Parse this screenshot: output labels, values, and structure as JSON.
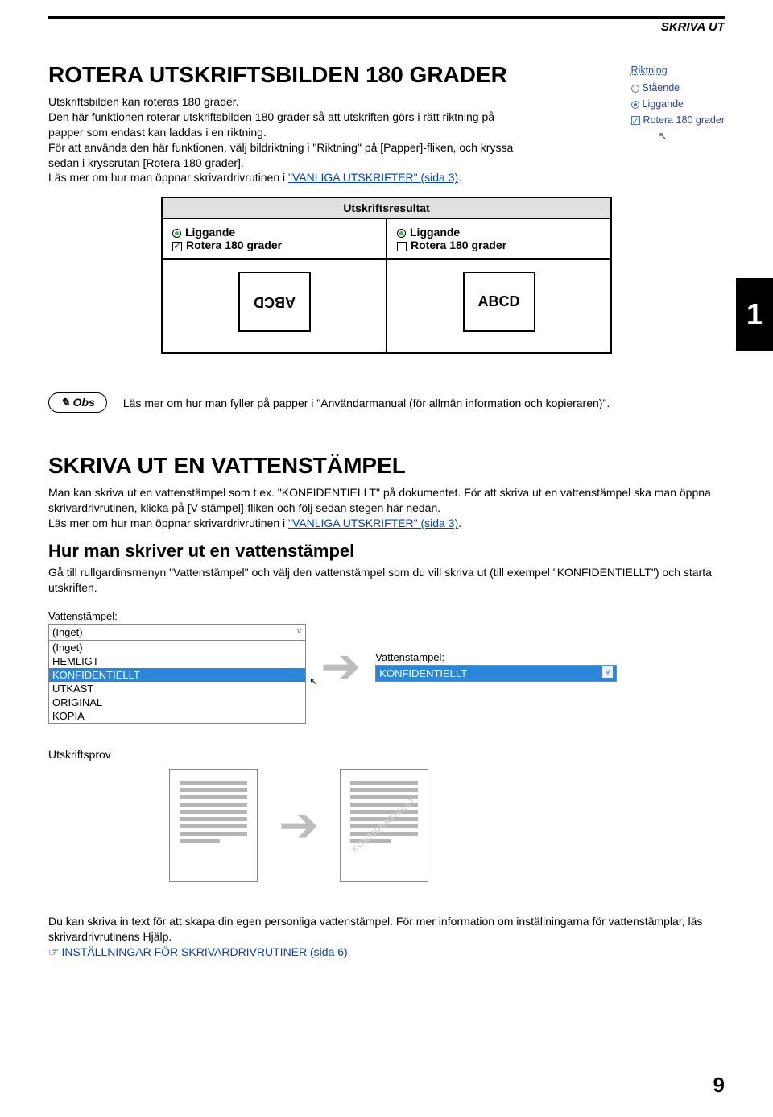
{
  "header": {
    "section": "SKRIVA UT"
  },
  "rotate": {
    "title": "ROTERA UTSKRIFTSBILDEN 180 GRADER",
    "intro": "Utskriftsbilden kan roteras 180 grader.",
    "p1": "Den här funktionen roterar utskriftsbilden 180 grader så att utskriften görs i rätt riktning på papper som endast kan laddas i en riktning.",
    "p2a": "För att använda den här funktionen, välj bildriktning i \"Riktning\" på [Papper]-fliken, och kryssa sedan i kryssrutan [Rotera 180 grader].",
    "p3a": "Läs mer om hur man öppnar skrivardrivrutinen i ",
    "p3link": "\"VANLIGA UTSKRIFTER\" (sida 3)",
    "p3b": "."
  },
  "riktning": {
    "title": "Riktning",
    "o1": "Stående",
    "o2": "Liggande",
    "o3": "Rotera 180 grader"
  },
  "resultTable": {
    "header": "Utskriftsresultat",
    "col1_opt1": "Liggande",
    "col1_opt2": "Rotera 180 grader",
    "col2_opt1": "Liggande",
    "col2_opt2": "Rotera 180 grader",
    "abcd": "ABCD"
  },
  "sideTab": "1",
  "obs": {
    "label": "Obs",
    "text": "Läs mer om hur man fyller på papper i \"Användarmanual (för allmän information och kopieraren)\"."
  },
  "watermark": {
    "title": "SKRIVA UT EN VATTENSTÄMPEL",
    "p1": "Man kan skriva ut en vattenstämpel som t.ex. \"KONFIDENTIELLT\" på dokumentet. För att skriva ut en vattenstämpel ska man öppna skrivardrivrutinen, klicka på [V-stämpel]-fliken och följ sedan stegen här nedan.",
    "p2a": "Läs mer om hur man öppnar skrivardrivrutinen i ",
    "p2link": "\"VANLIGA UTSKRIFTER\" (sida 3)",
    "p2b": ".",
    "subTitle": "Hur man skriver ut en vattenstämpel",
    "p3": "Gå till rullgardinsmenyn \"Vattenstämpel\" och välj den vattenstämpel som du vill skriva ut (till exempel \"KONFIDENTIELLT\") och starta utskriften."
  },
  "dropdown": {
    "label": "Vattenstämpel:",
    "selected": "(Inget)",
    "items": [
      "(Inget)",
      "HEMLIGT",
      "KONFIDENTIELLT",
      "UTKAST",
      "ORIGINAL",
      "KOPIA"
    ],
    "highlight": "KONFIDENTIELLT"
  },
  "dropdown2": {
    "label": "Vattenstämpel:",
    "selected": "KONFIDENTIELLT"
  },
  "prov": {
    "label": "Utskriftsprov",
    "wm": "KONFIDENTIELLT"
  },
  "footer": {
    "text": "Du kan skriva in text för att skapa din egen personliga vattenstämpel. För mer information om inställningarna för vattenstämplar, läs skrivardrivrutinens Hjälp.",
    "hand": "☞",
    "link": "INSTÄLLNINGAR FÖR SKRIVARDRIVRUTINER (sida 6)"
  },
  "pageNum": "9"
}
